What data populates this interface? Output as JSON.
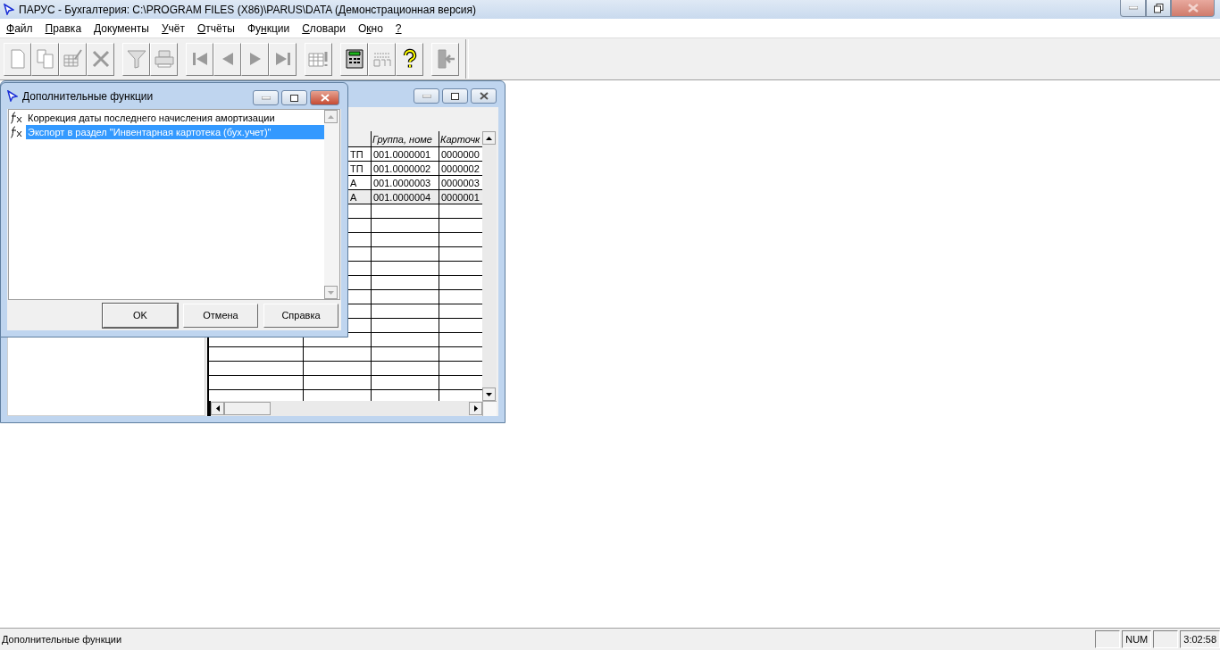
{
  "window": {
    "title": "ПАРУС - Бухгалтерия: C:\\PROGRAM FILES (X86)\\PARUS\\DATA (Демонстрационная версия)"
  },
  "menu": [
    {
      "key": "Ф",
      "after": "айл"
    },
    {
      "key": "П",
      "after": "равка"
    },
    {
      "key": "Д",
      "after": "окументы"
    },
    {
      "key": "У",
      "after": "чёт"
    },
    {
      "key": "О",
      "after": "тчёты"
    },
    {
      "before": "Фу",
      "key": "н",
      "after": "кции"
    },
    {
      "key": "С",
      "after": "ловари"
    },
    {
      "before": "О",
      "key": "к",
      "after": "но"
    },
    {
      "key": "?"
    }
  ],
  "toolbar": [
    [
      {
        "kind": "new",
        "disabled": true
      },
      {
        "kind": "copy",
        "disabled": true
      },
      {
        "kind": "edit",
        "disabled": true
      },
      {
        "kind": "delete",
        "disabled": true
      }
    ],
    [
      {
        "kind": "filter",
        "disabled": true
      },
      {
        "kind": "print",
        "disabled": true
      }
    ],
    [
      {
        "kind": "first",
        "disabled": true
      },
      {
        "kind": "prev",
        "disabled": true
      },
      {
        "kind": "next",
        "disabled": true
      },
      {
        "kind": "last",
        "disabled": true
      }
    ],
    [
      {
        "kind": "table-alert",
        "disabled": true
      }
    ],
    [
      {
        "kind": "calculator",
        "disabled": false
      },
      {
        "kind": "logo",
        "disabled": true
      },
      {
        "kind": "help",
        "disabled": false
      }
    ],
    [
      {
        "kind": "exit",
        "disabled": true
      }
    ]
  ],
  "document_window": {
    "header": {
      "column_3": "Группа, номе",
      "column_4": "Карточк"
    },
    "rows": [
      {
        "column_2": "ТП",
        "column_3": "001.0000001",
        "column_4": "0000000",
        "selected": false
      },
      {
        "column_2": "ТП",
        "column_3": "001.0000002",
        "column_4": "0000002",
        "selected": false
      },
      {
        "column_2": "А",
        "column_3": "001.0000003",
        "column_4": "0000003",
        "selected": false
      },
      {
        "column_2": "А",
        "column_3": "001.0000004",
        "column_4": "0000001",
        "selected": true
      }
    ]
  },
  "dialog": {
    "title": "Дополнительные функции",
    "items": [
      {
        "label": "Коррекция даты последнего начисления амортизации",
        "selected": false
      },
      {
        "label": "Экспорт в раздел \"Инвентарная картотека (бух.учет)\"",
        "selected": true
      }
    ],
    "buttons": [
      {
        "label": "OK",
        "default": true
      },
      {
        "label": "Отмена",
        "default": false
      },
      {
        "label": "Справка",
        "default": false
      }
    ]
  },
  "status_bar": {
    "text": "Дополнительные функции",
    "panels": [
      {
        "kind": "empty"
      },
      {
        "kind": "text",
        "text": "NUM"
      },
      {
        "kind": "empty"
      },
      {
        "kind": "text",
        "text": "3:02:58"
      }
    ]
  }
}
